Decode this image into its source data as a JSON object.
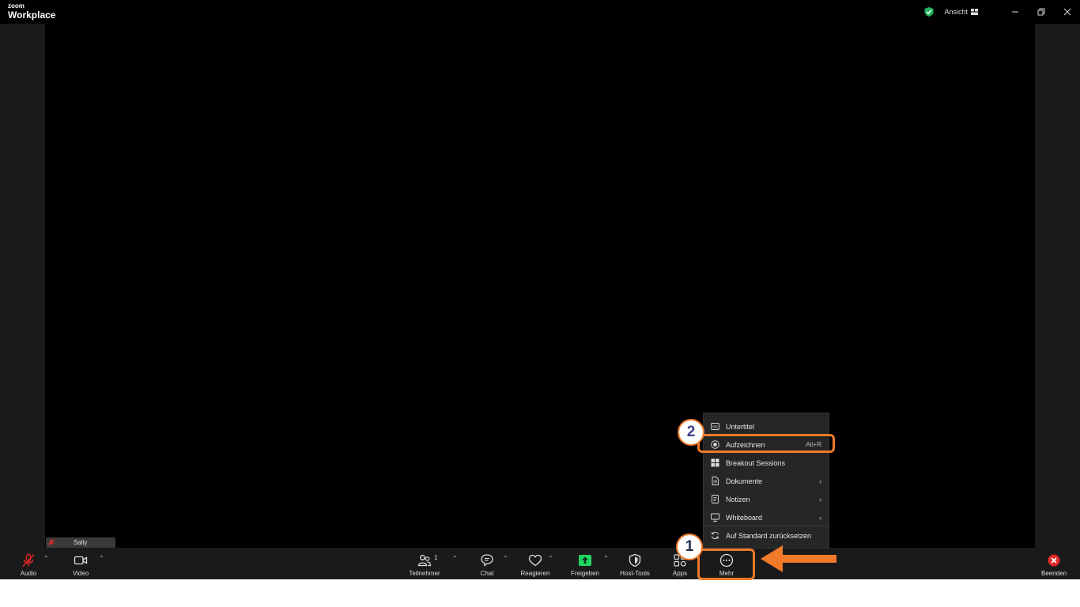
{
  "titlebar": {
    "logo_top": "zoom",
    "logo_bottom": "Workplace",
    "view_label": "Ansicht"
  },
  "participant_tile": {
    "name": "Sally"
  },
  "toolbar": {
    "audio": "Audio",
    "video": "Video",
    "participants": "Teilnehmer",
    "participants_count": "1",
    "chat": "Chat",
    "react": "Reagieren",
    "share": "Freigeben",
    "host_tools": "Host-Tools",
    "apps": "Apps",
    "more": "Mehr",
    "end": "Beenden"
  },
  "more_menu": {
    "items": [
      {
        "label": "Untertitel",
        "icon": "cc-icon"
      },
      {
        "label": "Aufzeichnen",
        "icon": "record-icon",
        "shortcut": "Alt+R"
      },
      {
        "label": "Breakout Sessions",
        "icon": "grid-icon"
      },
      {
        "label": "Dokumente",
        "icon": "document-icon",
        "submenu": true
      },
      {
        "label": "Notizen",
        "icon": "notes-icon",
        "submenu": true
      },
      {
        "label": "Whiteboard",
        "icon": "whiteboard-icon",
        "submenu": true
      },
      {
        "label": "Auf Standard zurücksetzen",
        "icon": "reset-icon"
      }
    ]
  },
  "annotations": {
    "step1": "1",
    "step2": "2",
    "highlight_color": "#f07a2a"
  },
  "colors": {
    "background": "#1a1a1a",
    "video": "#000000",
    "share_green": "#1ed760",
    "end_red": "#e02828",
    "shield_green": "#23b35d"
  }
}
